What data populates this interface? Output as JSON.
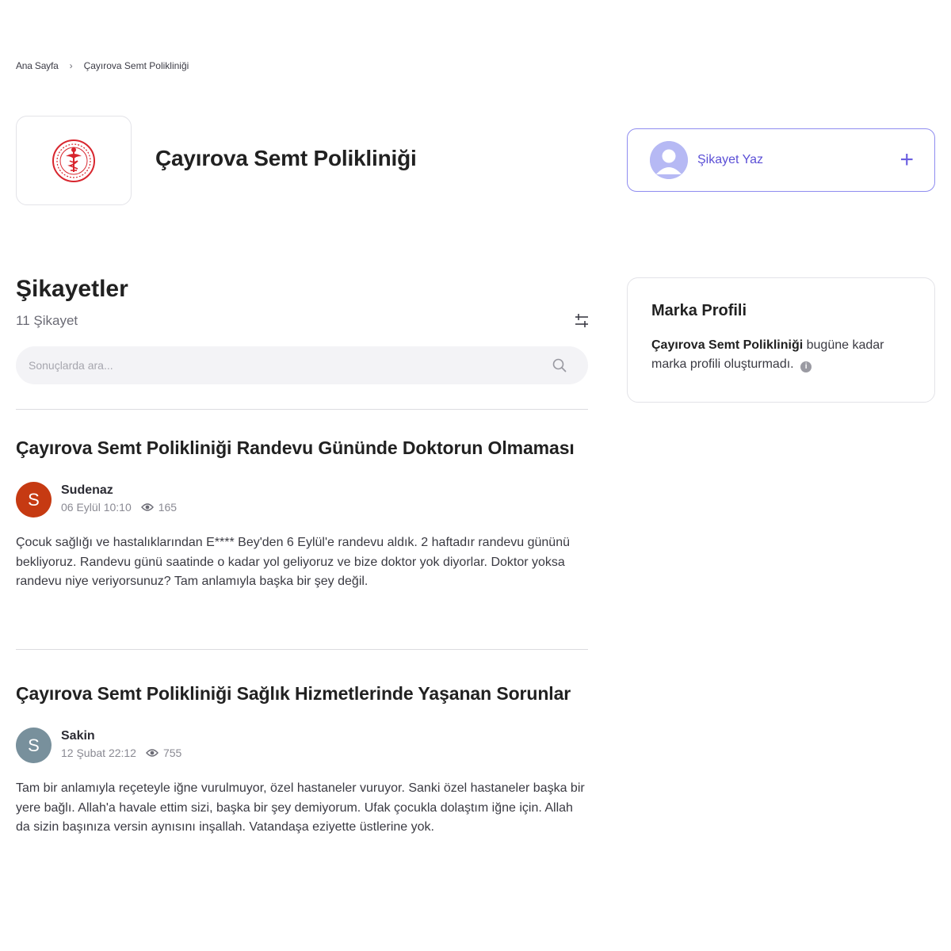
{
  "breadcrumb": {
    "home": "Ana Sayfa",
    "separator": "›",
    "current": "Çayırova Semt Polikliniği"
  },
  "brand": {
    "name": "Çayırova Semt Polikliniği",
    "logo_icon": "health-ministry-logo-icon",
    "logo_color": "#d8262e"
  },
  "write_button": {
    "label": "Şikayet Yaz",
    "plus": "+",
    "accent": "#5b4fd6"
  },
  "complaints_section": {
    "title": "Şikayetler",
    "count": "11 Şikayet",
    "filter_icon": "sliders-icon",
    "search": {
      "placeholder": "Sonuçlarda ara..."
    }
  },
  "complaints": [
    {
      "title": "Çayırova Semt Polikliniği Randevu Gününde Doktorun Olmaması",
      "avatar_letter": "S",
      "avatar_color": "#c63a12",
      "user": "Sudenaz",
      "date": "06 Eylül 10:10",
      "views": "165",
      "body": "Çocuk sağlığı ve hastalıklarından E**** Bey'den 6 Eylül'e randevu aldık. 2 haftadır randevu gününü bekliyoruz. Randevu günü saatinde o kadar yol geliyoruz ve bize doktor yok diyorlar. Doktor yoksa randevu niye veriyorsunuz? Tam anlamıyla başka bir şey değil."
    },
    {
      "title": "Çayırova Semt Polikliniği Sağlık Hizmetlerinde Yaşanan Sorunlar",
      "avatar_letter": "S",
      "avatar_color": "#78909c",
      "user": "Sakin",
      "date": "12 Şubat 22:12",
      "views": "755",
      "body": "Tam bir anlamıyla reçeteyle iğne vurulmuyor, özel hastaneler vuruyor. Sanki özel hastaneler başka bir yere bağlı. Allah'a havale ettim sizi, başka bir şey demiyorum. Ufak çocukla dolaştım iğne için. Allah da sizin başınıza versin aynısını inşallah. Vatandaşa eziyette üstlerine yok."
    }
  ],
  "brand_profile": {
    "title": "Marka Profili",
    "brand_name": "Çayırova Semt Polikliniği",
    "message": "bugüne kadar marka profili oluşturmadı.",
    "info_icon": "i"
  }
}
